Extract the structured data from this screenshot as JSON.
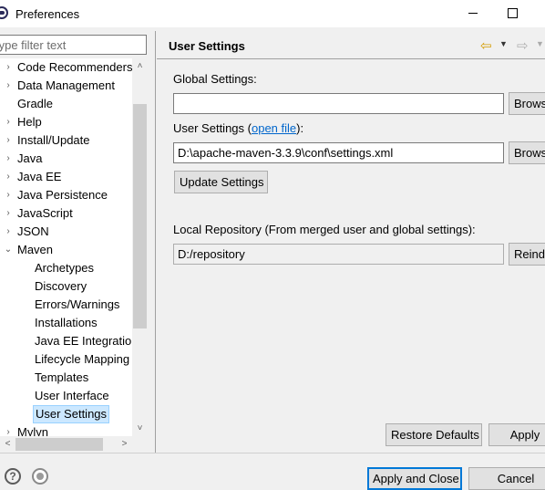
{
  "window": {
    "title": "Preferences"
  },
  "filter": {
    "placeholder": "type filter text"
  },
  "tree": {
    "items": [
      {
        "label": "Code Recommenders",
        "expander": "›"
      },
      {
        "label": "Data Management",
        "expander": "›"
      },
      {
        "label": "Gradle",
        "expander": ""
      },
      {
        "label": "Help",
        "expander": "›"
      },
      {
        "label": "Install/Update",
        "expander": "›"
      },
      {
        "label": "Java",
        "expander": "›"
      },
      {
        "label": "Java EE",
        "expander": "›"
      },
      {
        "label": "Java Persistence",
        "expander": "›"
      },
      {
        "label": "JavaScript",
        "expander": "›"
      },
      {
        "label": "JSON",
        "expander": "›"
      },
      {
        "label": "Maven",
        "expander": "⌄"
      },
      {
        "label": "Archetypes",
        "expander": ""
      },
      {
        "label": "Discovery",
        "expander": ""
      },
      {
        "label": "Errors/Warnings",
        "expander": ""
      },
      {
        "label": "Installations",
        "expander": ""
      },
      {
        "label": "Java EE Integration",
        "expander": ""
      },
      {
        "label": "Lifecycle Mapping",
        "expander": ""
      },
      {
        "label": "Templates",
        "expander": ""
      },
      {
        "label": "User Interface",
        "expander": ""
      },
      {
        "label": "User Settings",
        "expander": ""
      },
      {
        "label": "Mylyn",
        "expander": "›"
      }
    ],
    "selected": "User Settings"
  },
  "page": {
    "title": "User Settings",
    "global_settings_label": "Global Settings:",
    "global_settings_value": "",
    "user_settings_label_prefix": "User Settings (",
    "user_settings_link": "open file",
    "user_settings_label_suffix": "):",
    "user_settings_value": "D:\\apache-maven-3.3.9\\conf\\settings.xml",
    "browse_label": "Browse...",
    "update_settings_label": "Update Settings",
    "local_repo_label": "Local Repository (From merged user and global settings):",
    "local_repo_value": "D:/repository",
    "reindex_label": "Reindex",
    "restore_defaults_label": "Restore Defaults",
    "apply_label": "Apply"
  },
  "footer": {
    "apply_and_close_label": "Apply and Close",
    "cancel_label": "Cancel"
  },
  "icons": {
    "back": "arrow-left-icon",
    "forward": "arrow-right-icon",
    "help": "help-icon",
    "record": "record-macro-icon"
  }
}
